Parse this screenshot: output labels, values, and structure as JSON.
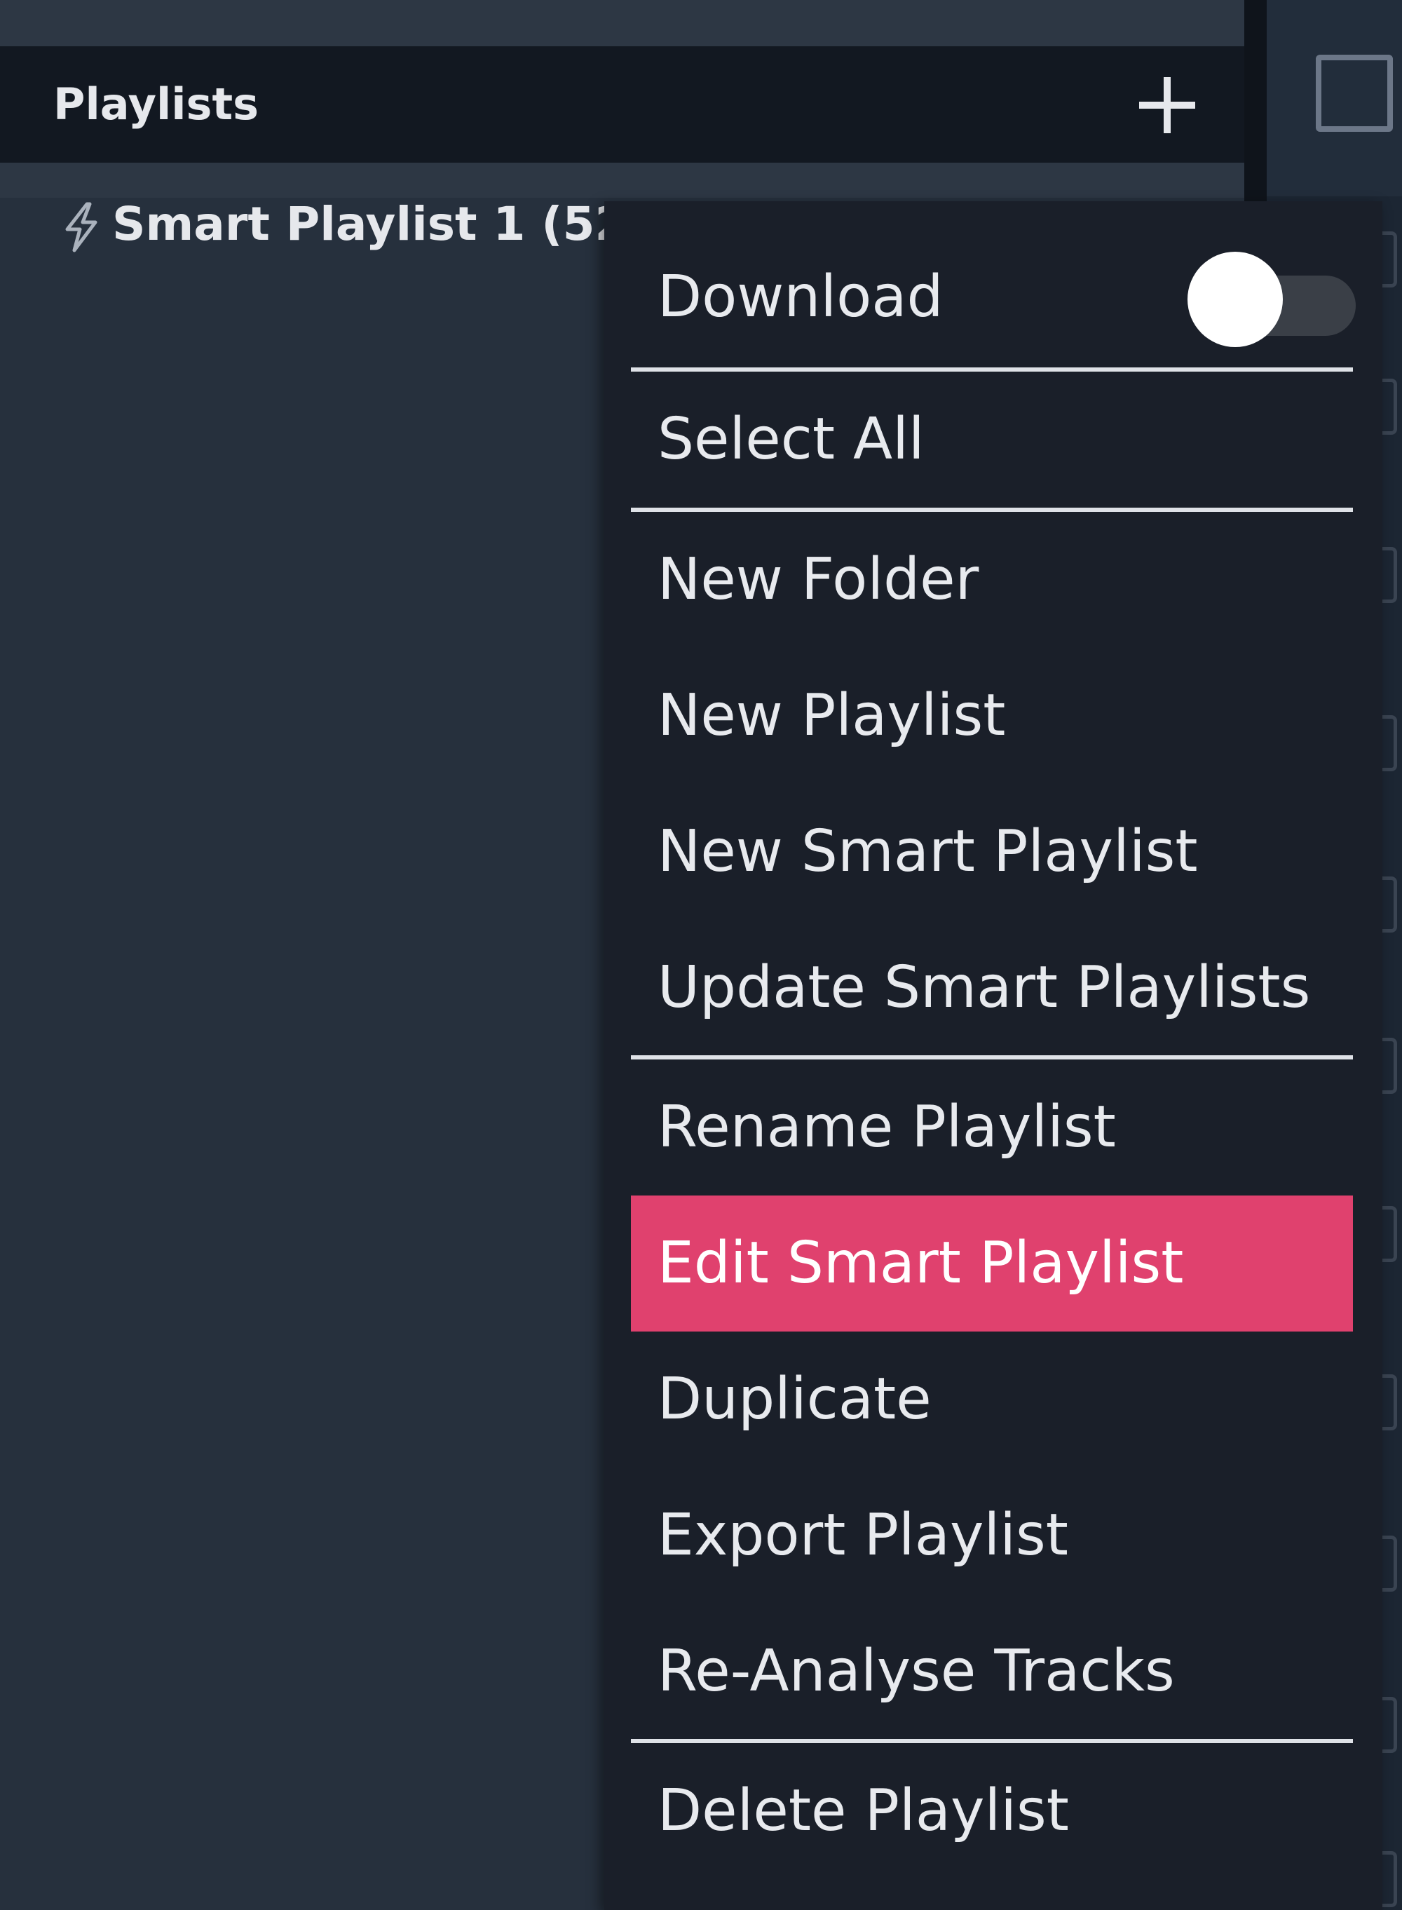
{
  "panel": {
    "title": "Playlists",
    "add_icon": "plus-icon"
  },
  "playlist_item": {
    "icon": "bolt-icon",
    "label": "Smart Playlist 1 (52"
  },
  "context_menu": {
    "download_label": "Download",
    "download_toggle": false,
    "items": [
      {
        "label": "Select All"
      },
      {
        "label": "New Folder"
      },
      {
        "label": "New Playlist"
      },
      {
        "label": "New Smart Playlist"
      },
      {
        "label": "Update Smart Playlists"
      },
      {
        "label": "Rename Playlist"
      },
      {
        "label": "Edit Smart Playlist"
      },
      {
        "label": "Duplicate"
      },
      {
        "label": "Export Playlist"
      },
      {
        "label": "Re-Analyse Tracks"
      },
      {
        "label": "Delete Playlist"
      }
    ],
    "highlighted_item": "Edit Smart Playlist",
    "highlight_color": "#e0416e"
  },
  "colors": {
    "panel_bg": "#26303d",
    "header_bg": "#121821",
    "menu_bg": "#1a1f29",
    "text": "#e8eaee"
  }
}
